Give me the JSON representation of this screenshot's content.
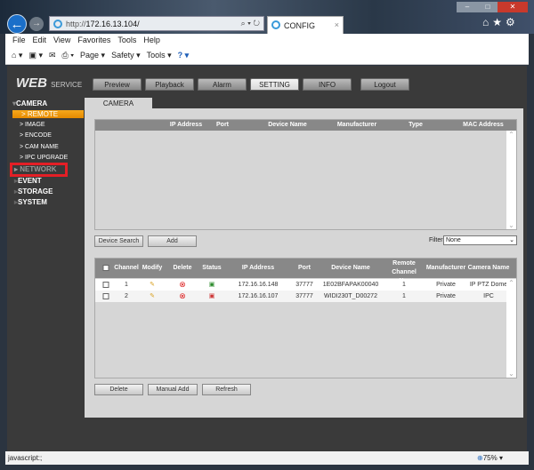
{
  "browser": {
    "url_prefix": "http://",
    "url_host": "172.16.13.104/",
    "tab_title": "CONFIG",
    "tab_close": "×",
    "search_refresh": "⌕ ▾ ↻",
    "right_icons": "⌂★⚙",
    "window_controls": [
      "–",
      "□",
      "✕"
    ],
    "menu": [
      "File",
      "Edit",
      "View",
      "Favorites",
      "Tools",
      "Help"
    ],
    "toolbar": [
      "⌂ ▾",
      "▣ ▾",
      "✉",
      "⎙ ▾",
      "Page ▾",
      "Safety ▾",
      "Tools ▾",
      "? ▾"
    ],
    "status_text": "javascript:;",
    "zoom": "75%"
  },
  "app": {
    "logo_main": "WEB",
    "logo_sub": "SERVICE",
    "nav_tabs": [
      "Preview",
      "Playback",
      "Alarm",
      "SETTING",
      "INFO",
      "Logout"
    ],
    "active_tab": "SETTING",
    "sidebar": {
      "camera": "CAMERA",
      "remote": "> REMOTE",
      "image": "> IMAGE",
      "encode": "> ENCODE",
      "cam_name": "> CAM NAME",
      "ipc_upgrade": "> IPC UPGRADE",
      "network": "▸ NETWORK",
      "event": "EVENT",
      "storage": "STORAGE",
      "system": "SYSTEM"
    },
    "highlight_color": "#e41f26",
    "accent": "#f39c12",
    "panel_tab": "CAMERA",
    "search_table": {
      "columns": [
        "IP Address",
        "Port",
        "Device Name",
        "Manufacturer",
        "Type",
        "MAC Address"
      ]
    },
    "device_search": "Device Search",
    "add": "Add",
    "filter_label": "Filter",
    "filter_value": "None",
    "added_table": {
      "columns": [
        "Channel",
        "Modify",
        "Delete",
        "Status",
        "IP Address",
        "Port",
        "Device Name",
        "Remote Channel No.",
        "Manufacturer",
        "Camera Name"
      ],
      "rows": [
        {
          "channel": "1",
          "ip": "172.16.16.148",
          "port": "37777",
          "device": "1E02BFAPAK00040",
          "remote": "1",
          "manufacturer": "Private",
          "camera": "IP PTZ Dome",
          "status": "online"
        },
        {
          "channel": "2",
          "ip": "172.16.16.107",
          "port": "37777",
          "device": "WIDI230T_D00272",
          "remote": "1",
          "manufacturer": "Private",
          "camera": "IPC",
          "status": "offline"
        }
      ]
    },
    "delete": "Delete",
    "manual_add": "Manual Add",
    "refresh": "Refresh"
  }
}
